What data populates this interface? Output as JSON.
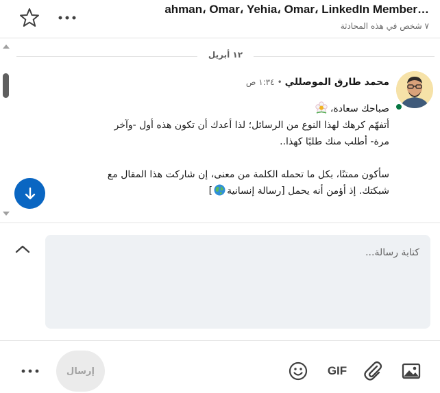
{
  "header": {
    "title": "…ahman، Omar، Yehia، Omar، LinkedIn Member",
    "subtitle": "٧ شخص في هذه المحادثة"
  },
  "thread": {
    "date_divider": "١٢ أبريل",
    "message": {
      "sender": "محمد طارق الموصللي",
      "separator": "•",
      "time": "١:٣٤ ص",
      "line1": "صباحك سعادة،",
      "line2": "أتفهّم كرهك لهذا النوع من الرسائل؛ لذا أعدك أن تكون هذه أول -وآخر",
      "line3": "مرة- أطلب منك طلبًا كهذا..",
      "line4": "سأكون ممتنًا، بكل ما تحمله الكلمة من معنى، إن شاركت هذا المقال مع",
      "line5_start": "شبكتك. إذ أؤمن أنه يحمل [رسالة إنسانية",
      "line5_end": "]"
    }
  },
  "composer": {
    "placeholder": "كتابة رسالة..."
  },
  "toolbar": {
    "send_label": "إرسال",
    "gif_label": "GIF"
  },
  "icons": {
    "star": "star-icon",
    "more": "more-horizontal-icon",
    "jump": "arrow-down-icon",
    "collapse": "chevron-up-icon",
    "emoji": "smiley-icon",
    "attach": "paperclip-icon",
    "image": "image-icon",
    "flower": "flower-emoji",
    "globe": "globe-emoji"
  },
  "colors": {
    "accent": "#0a66c2",
    "presence": "#057642",
    "compose_bg": "#eef1f4"
  }
}
